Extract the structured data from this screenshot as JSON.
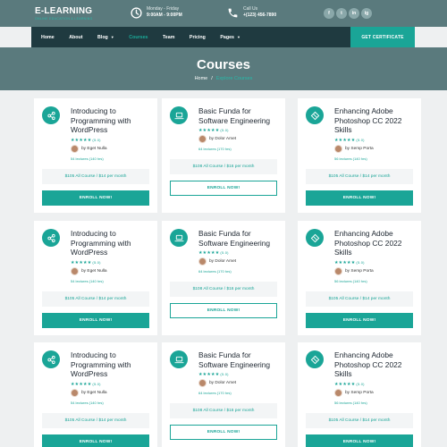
{
  "brand": {
    "name": "E-LEARNING",
    "tagline": "ONLINE EDUCATION & LEARNING"
  },
  "topinfo": {
    "hours_title": "Monday - Friday",
    "hours_value": "9:00AM - 9:00PM",
    "call_title": "Call Us",
    "call_value": "+(123) 456-7890"
  },
  "social": [
    "f",
    "t",
    "in",
    "ig"
  ],
  "nav": {
    "items": [
      {
        "label": "Home",
        "dropdown": false,
        "active": false
      },
      {
        "label": "About",
        "dropdown": false,
        "active": false
      },
      {
        "label": "Blog",
        "dropdown": true,
        "active": false
      },
      {
        "label": "Courses",
        "dropdown": false,
        "active": true
      },
      {
        "label": "Team",
        "dropdown": false,
        "active": false
      },
      {
        "label": "Pricing",
        "dropdown": false,
        "active": false
      },
      {
        "label": "Pages",
        "dropdown": true,
        "active": false
      }
    ],
    "cta": "GET CERTIFICATE"
  },
  "hero": {
    "title": "Courses",
    "breadcrumb_home": "Home",
    "breadcrumb_sep": "/",
    "breadcrumb_current": "Explore Courses"
  },
  "colors": {
    "accent": "#1aa597",
    "dark_nav": "#1f3a40",
    "header_bg": "#5a7a7d",
    "page_bg": "#eef0f1"
  },
  "cards": [
    {
      "icon": "share-nodes-icon",
      "title": "Introducing to Programming with WordPress",
      "stars": "★★★★★",
      "score": "(5.0)",
      "author": "by Eget Nulla",
      "lectures": "54 lectures (140 hrs)",
      "price": "$105 All Course / $14 per month",
      "button": "ENROLL NOW!",
      "outline": false
    },
    {
      "icon": "laptop-icon",
      "title": "Basic Funda for Software Engineering",
      "stars": "★★★★★",
      "score": "(5.0)",
      "author": "by Dolor Amet",
      "lectures": "64 lectures (170 hrs)",
      "price": "$108 All Course / $16 per month",
      "button": "ENROLL NOW!",
      "outline": true
    },
    {
      "icon": "design-icon",
      "title": "Enhancing Adobe Photoshop CC 2022 Skills",
      "stars": "★★★★★",
      "score": "(5.0)",
      "author": "by Semp Porta",
      "lectures": "56 lectures (140 hrs)",
      "price": "$105 All Course / $14 per month",
      "button": "ENROLL NOW!",
      "outline": false
    },
    {
      "icon": "share-nodes-icon",
      "title": "Introducing to Programming with WordPress",
      "stars": "★★★★★",
      "score": "(5.0)",
      "author": "by Eget Nulla",
      "lectures": "54 lectures (140 hrs)",
      "price": "$105 All Course / $14 per month",
      "button": "ENROLL NOW!",
      "outline": false
    },
    {
      "icon": "laptop-icon",
      "title": "Basic Funda for Software Engineering",
      "stars": "★★★★★",
      "score": "(5.0)",
      "author": "by Dolor Amet",
      "lectures": "64 lectures (170 hrs)",
      "price": "$108 All Course / $16 per month",
      "button": "ENROLL NOW!",
      "outline": true
    },
    {
      "icon": "design-icon",
      "title": "Enhancing Adobe Photoshop CC 2022 Skills",
      "stars": "★★★★★",
      "score": "(5.0)",
      "author": "by Semp Porta",
      "lectures": "56 lectures (140 hrs)",
      "price": "$105 All Course / $14 per month",
      "button": "ENROLL NOW!",
      "outline": false
    },
    {
      "icon": "share-nodes-icon",
      "title": "Introducing to Programming with WordPress",
      "stars": "★★★★★",
      "score": "(5.0)",
      "author": "by Eget Nulla",
      "lectures": "54 lectures (140 hrs)",
      "price": "$105 All Course / $14 per month",
      "button": "ENROLL NOW!",
      "outline": false
    },
    {
      "icon": "laptop-icon",
      "title": "Basic Funda for Software Engineering",
      "stars": "★★★★★",
      "score": "(5.0)",
      "author": "by Dolor Amet",
      "lectures": "64 lectures (170 hrs)",
      "price": "$108 All Course / $16 per month",
      "button": "ENROLL NOW!",
      "outline": true
    },
    {
      "icon": "design-icon",
      "title": "Enhancing Adobe Photoshop CC 2022 Skills",
      "stars": "★★★★★",
      "score": "(5.0)",
      "author": "by Semp Porta",
      "lectures": "56 lectures (140 hrs)",
      "price": "$105 All Course / $14 per month",
      "button": "ENROLL NOW!",
      "outline": false
    }
  ]
}
